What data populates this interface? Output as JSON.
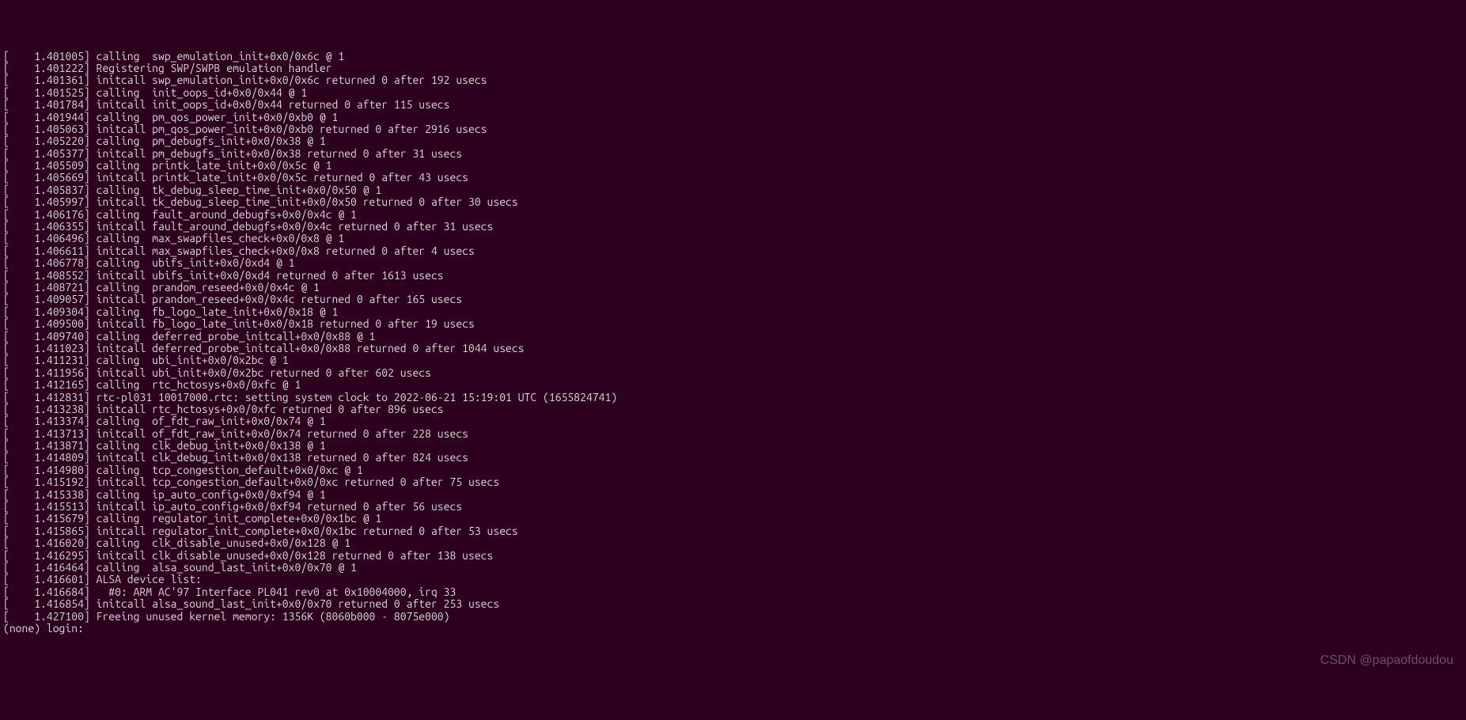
{
  "terminal": {
    "lines": [
      "[    1.401005] calling  swp_emulation_init+0x0/0x6c @ 1",
      "[    1.401222] Registering SWP/SWPB emulation handler",
      "[    1.401361] initcall swp_emulation_init+0x0/0x6c returned 0 after 192 usecs",
      "[    1.401525] calling  init_oops_id+0x0/0x44 @ 1",
      "[    1.401784] initcall init_oops_id+0x0/0x44 returned 0 after 115 usecs",
      "[    1.401944] calling  pm_qos_power_init+0x0/0xb0 @ 1",
      "[    1.405063] initcall pm_qos_power_init+0x0/0xb0 returned 0 after 2916 usecs",
      "[    1.405220] calling  pm_debugfs_init+0x0/0x38 @ 1",
      "[    1.405377] initcall pm_debugfs_init+0x0/0x38 returned 0 after 31 usecs",
      "[    1.405509] calling  printk_late_init+0x0/0x5c @ 1",
      "[    1.405669] initcall printk_late_init+0x0/0x5c returned 0 after 43 usecs",
      "[    1.405837] calling  tk_debug_sleep_time_init+0x0/0x50 @ 1",
      "[    1.405997] initcall tk_debug_sleep_time_init+0x0/0x50 returned 0 after 30 usecs",
      "[    1.406176] calling  fault_around_debugfs+0x0/0x4c @ 1",
      "[    1.406355] initcall fault_around_debugfs+0x0/0x4c returned 0 after 31 usecs",
      "[    1.406496] calling  max_swapfiles_check+0x0/0x8 @ 1",
      "[    1.406611] initcall max_swapfiles_check+0x0/0x8 returned 0 after 4 usecs",
      "[    1.406778] calling  ubifs_init+0x0/0xd4 @ 1",
      "[    1.408552] initcall ubifs_init+0x0/0xd4 returned 0 after 1613 usecs",
      "[    1.408721] calling  prandom_reseed+0x0/0x4c @ 1",
      "[    1.409057] initcall prandom_reseed+0x0/0x4c returned 0 after 165 usecs",
      "[    1.409304] calling  fb_logo_late_init+0x0/0x18 @ 1",
      "[    1.409500] initcall fb_logo_late_init+0x0/0x18 returned 0 after 19 usecs",
      "[    1.409740] calling  deferred_probe_initcall+0x0/0x88 @ 1",
      "[    1.411023] initcall deferred_probe_initcall+0x0/0x88 returned 0 after 1044 usecs",
      "[    1.411231] calling  ubi_init+0x0/0x2bc @ 1",
      "[    1.411956] initcall ubi_init+0x0/0x2bc returned 0 after 602 usecs",
      "[    1.412165] calling  rtc_hctosys+0x0/0xfc @ 1",
      "[    1.412831] rtc-pl031 10017000.rtc: setting system clock to 2022-06-21 15:19:01 UTC (1655824741)",
      "[    1.413238] initcall rtc_hctosys+0x0/0xfc returned 0 after 896 usecs",
      "[    1.413374] calling  of_fdt_raw_init+0x0/0x74 @ 1",
      "[    1.413713] initcall of_fdt_raw_init+0x0/0x74 returned 0 after 228 usecs",
      "[    1.413871] calling  clk_debug_init+0x0/0x138 @ 1",
      "[    1.414809] initcall clk_debug_init+0x0/0x138 returned 0 after 824 usecs",
      "[    1.414980] calling  tcp_congestion_default+0x0/0xc @ 1",
      "[    1.415192] initcall tcp_congestion_default+0x0/0xc returned 0 after 75 usecs",
      "[    1.415338] calling  ip_auto_config+0x0/0xf94 @ 1",
      "[    1.415513] initcall ip_auto_config+0x0/0xf94 returned 0 after 56 usecs",
      "[    1.415679] calling  regulator_init_complete+0x0/0x1bc @ 1",
      "[    1.415865] initcall regulator_init_complete+0x0/0x1bc returned 0 after 53 usecs",
      "[    1.416020] calling  clk_disable_unused+0x0/0x128 @ 1",
      "[    1.416295] initcall clk_disable_unused+0x0/0x128 returned 0 after 138 usecs",
      "[    1.416464] calling  alsa_sound_last_init+0x0/0x70 @ 1",
      "[    1.416601] ALSA device list:",
      "[    1.416684]   #0: ARM AC'97 Interface PL041 rev0 at 0x10004000, irq 33",
      "[    1.416854] initcall alsa_sound_last_init+0x0/0x70 returned 0 after 253 usecs",
      "[    1.427100] Freeing unused kernel memory: 1356K (8060b000 - 8075e000)",
      "(none) login:"
    ]
  },
  "watermark": "CSDN @papaofdoudou"
}
